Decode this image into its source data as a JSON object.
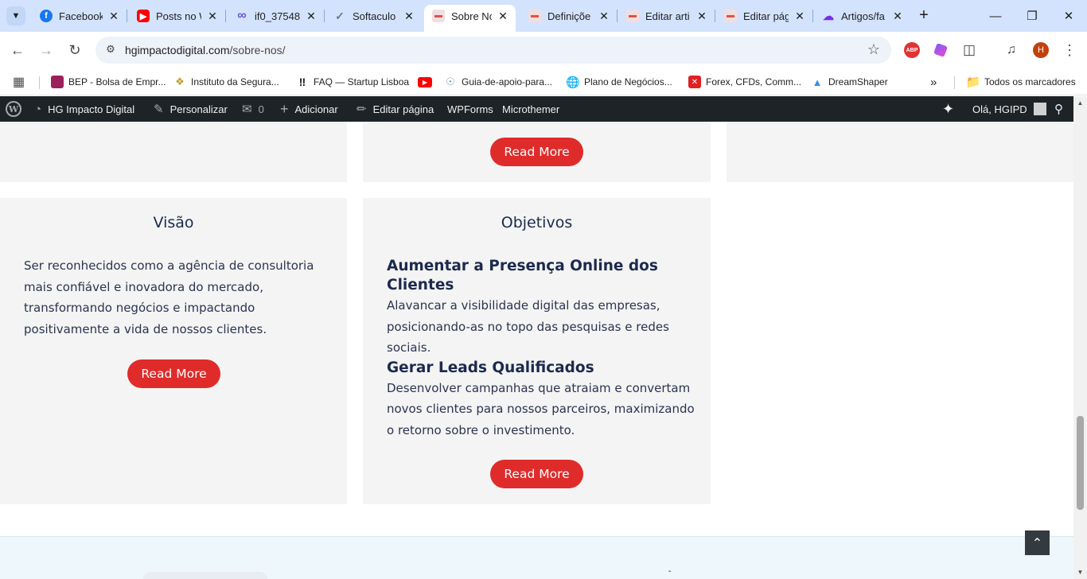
{
  "browser": {
    "tabs": [
      {
        "title": "Facebook",
        "icon": "facebook-icon",
        "color": "#1877f2"
      },
      {
        "title": "Posts no W",
        "icon": "youtube-icon",
        "color": "#ff0000"
      },
      {
        "title": "if0_37548",
        "icon": "infinity-icon",
        "color": "#6b4fd8"
      },
      {
        "title": "Softaculo",
        "icon": "softaculous-icon",
        "color": "#6b7a90"
      },
      {
        "title": "Sobre Nó",
        "icon": "site-icon",
        "color": "#d9534f",
        "active": true
      },
      {
        "title": "Definiçõe",
        "icon": "site-icon",
        "color": "#d9534f"
      },
      {
        "title": "Editar arti",
        "icon": "site-icon",
        "color": "#d9534f"
      },
      {
        "title": "Editar pág",
        "icon": "site-icon",
        "color": "#d9534f"
      },
      {
        "title": "Artigos/fa",
        "icon": "canva-icon",
        "color": "#7d2ae8"
      }
    ],
    "url_host": "hgimpactodigital.com",
    "url_path": "/sobre-nos/",
    "profile_initial": "H",
    "abp_label": "ABP",
    "bookmarks": [
      {
        "label": "BEP - Bolsa de Empr...",
        "icon": "bep-icon"
      },
      {
        "label": "Instituto da Segura...",
        "icon": "insurance-icon"
      },
      {
        "label": "FAQ — Startup Lisboa",
        "icon": "startup-icon"
      },
      {
        "label": "",
        "icon": "youtube-icon"
      },
      {
        "label": "Guia-de-apoio-para...",
        "icon": "guide-icon"
      },
      {
        "label": "Plano de Negócios...",
        "icon": "globe-icon"
      },
      {
        "label": "Forex, CFDs, Comm...",
        "icon": "forex-icon"
      },
      {
        "label": "DreamShaper",
        "icon": "dreamshaper-icon"
      }
    ],
    "all_bookmarks": "Todos os marcadores"
  },
  "wp_admin_bar": {
    "site_name": "HG Impacto Digital",
    "customize": "Personalizar",
    "comments_count": "0",
    "add_new": "Adicionar",
    "edit_page": "Editar página",
    "wpforms": "WPForms",
    "microthemer": "Microthemer",
    "greeting": "Olá, HGIPD"
  },
  "content": {
    "read_more_label": "Read More",
    "vision": {
      "title": "Visão",
      "text": "Ser reconhecidos como a agência de consultoria mais confiável e inovadora do mercado, transformando negócios e impactando positivamente a vida de nossos clientes."
    },
    "objectives": {
      "title": "Objetivos",
      "items": [
        {
          "heading": "Aumentar a Presença Online dos Clientes",
          "text": "Alavancar a visibilidade digital das empresas, posicionando-as no topo das pesquisas e redes sociais."
        },
        {
          "heading": "Gerar Leads Qualificados",
          "text": "Desenvolver campanhas que atraiam e convertam novos clientes para nossos parceiros, maximizando o retorno sobre o investimento."
        }
      ]
    }
  },
  "colors": {
    "accent_red": "#e02b2b",
    "heading_navy": "#1b2a4e",
    "card_bg": "#f4f4f4",
    "wp_bar": "#1d2327",
    "tab_strip": "#d3e3fd"
  }
}
